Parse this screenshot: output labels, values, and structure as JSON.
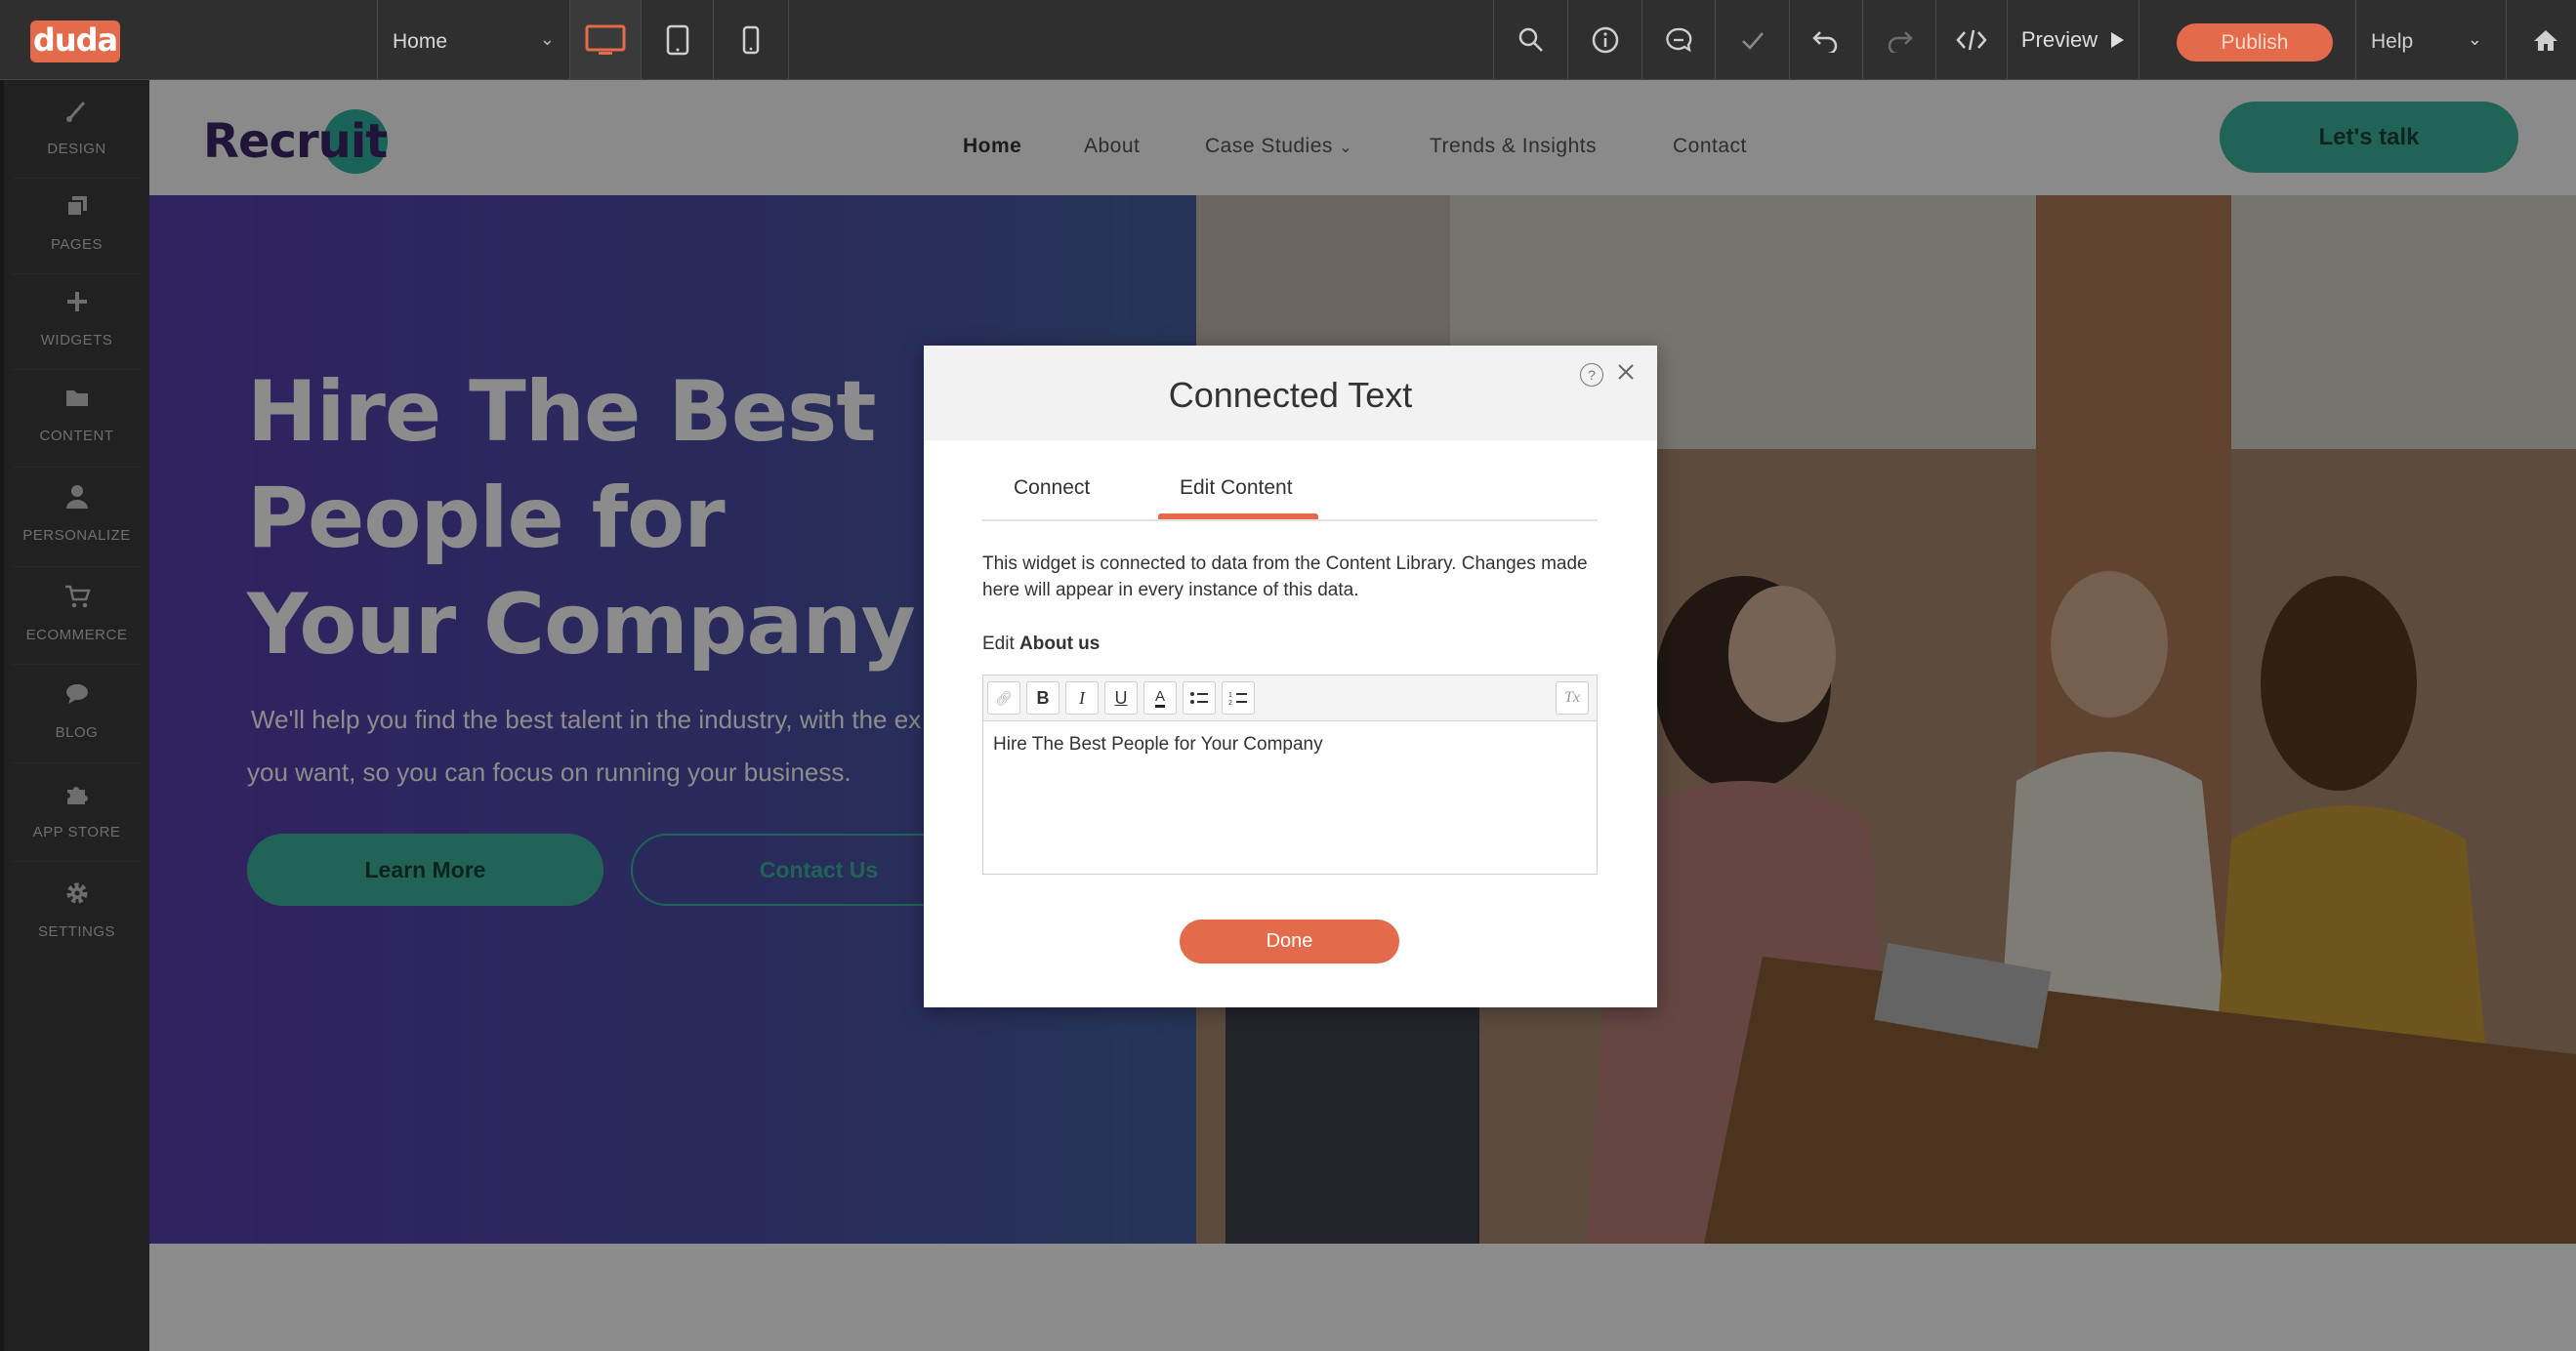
{
  "topbar": {
    "logo": "duda",
    "page_select": "Home",
    "preview_label": "Preview",
    "publish_label": "Publish",
    "help_label": "Help",
    "accent": "#e36a4a"
  },
  "sidebar": {
    "items": [
      {
        "label": "DESIGN",
        "icon": "brush-icon"
      },
      {
        "label": "PAGES",
        "icon": "pages-icon"
      },
      {
        "label": "WIDGETS",
        "icon": "plus-icon"
      },
      {
        "label": "CONTENT",
        "icon": "folder-icon"
      },
      {
        "label": "PERSONALIZE",
        "icon": "user-icon"
      },
      {
        "label": "ECOMMERCE",
        "icon": "cart-icon"
      },
      {
        "label": "BLOG",
        "icon": "chat-icon"
      },
      {
        "label": "APP STORE",
        "icon": "puzzle-icon"
      },
      {
        "label": "SETTINGS",
        "icon": "gear-icon"
      }
    ]
  },
  "site": {
    "brand": "Recruit",
    "brand_main": "Recru",
    "brand_it": "it",
    "nav": [
      "Home",
      "About",
      "Case Studies",
      "Trends & Insights",
      "Contact"
    ],
    "cta": "Let's talk",
    "hero_title": "Hire The Best People for Your Company",
    "hero_sub_line1": "We'll help you find the best talent in the industry, with the ex",
    "hero_sub_line2": "you want, so you can focus on running your business.",
    "learn_more": "Learn More",
    "contact_us": "Contact Us",
    "brand_color": "#3b2566",
    "teal": "#3fb5a0"
  },
  "modal": {
    "title": "Connected Text",
    "tabs": [
      "Connect",
      "Edit Content"
    ],
    "active_tab": "Edit Content",
    "notice": "This widget is connected to data from the Content Library. Changes made here will appear in every instance of this data.",
    "edit_prefix": "Edit",
    "edit_field": "About us",
    "editor_value": "Hire The Best People for Your Company",
    "done_label": "Done"
  }
}
